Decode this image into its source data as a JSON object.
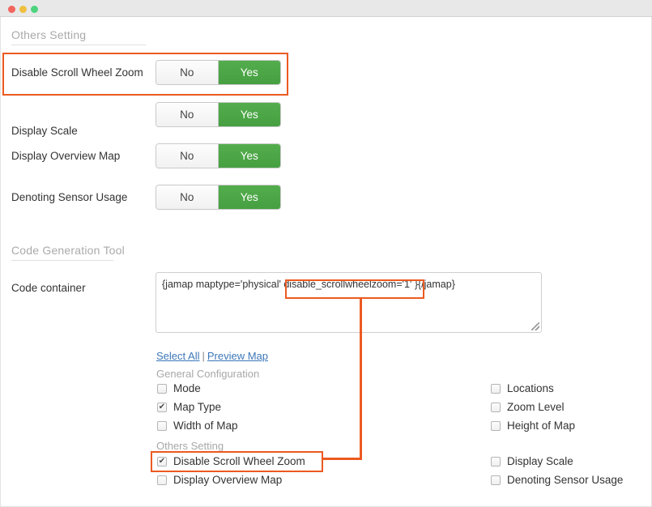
{
  "window": {
    "traffic_lights": [
      "close-dot",
      "minimize-dot",
      "maximize-dot"
    ],
    "colors": {
      "close": "#f2645d",
      "minimize": "#efbf3f",
      "maximize": "#4cd37d",
      "accent_green": "#4aa344",
      "annotation_orange": "#ec5a21",
      "link_blue": "#3c77b8",
      "heading_gray": "#aaaaaa"
    }
  },
  "others_setting": {
    "heading": "Others Setting",
    "rows": [
      {
        "label": "Disable Scroll Wheel Zoom",
        "no": "No",
        "yes": "Yes",
        "selected": "Yes",
        "highlighted": true
      },
      {
        "label": "Display Scale",
        "no": "No",
        "yes": "Yes",
        "selected": "Yes",
        "highlighted": false
      },
      {
        "label": "Display Overview Map",
        "no": "No",
        "yes": "Yes",
        "selected": "Yes",
        "highlighted": false
      },
      {
        "label": "Denoting Sensor Usage",
        "no": "No",
        "yes": "Yes",
        "selected": "Yes",
        "highlighted": false
      }
    ]
  },
  "code_generation_tool": {
    "heading": "Code Generation Tool",
    "field_label": "Code container",
    "code_prefix": "{jamap maptype='physical'",
    "code_highlight": "disable_scrollwheelzoom='1'",
    "code_suffix": "}{/jamap}",
    "code_full": "{jamap maptype='physical' disable_scrollwheelzoom='1' }{/jamap}",
    "links": {
      "select_all": "Select All",
      "separator": "|",
      "preview_map": "Preview Map"
    }
  },
  "checkbox_panel": {
    "left_column": {
      "general_title": "General Configuration",
      "general_items": [
        {
          "label": "Mode",
          "checked": false
        },
        {
          "label": "Map Type",
          "checked": true
        },
        {
          "label": "Width of Map",
          "checked": false
        }
      ],
      "others_title": "Others Setting",
      "others_items": [
        {
          "label": "Disable Scroll Wheel Zoom",
          "checked": true,
          "highlighted": true
        },
        {
          "label": "Display Overview Map",
          "checked": false,
          "highlighted": false
        }
      ]
    },
    "right_column": {
      "general_items": [
        {
          "label": "Locations",
          "checked": false
        },
        {
          "label": "Zoom Level",
          "checked": false
        },
        {
          "label": "Height of Map",
          "checked": false
        }
      ],
      "others_items": [
        {
          "label": "Display Scale",
          "checked": false
        },
        {
          "label": "Denoting Sensor Usage",
          "checked": false
        }
      ]
    }
  }
}
